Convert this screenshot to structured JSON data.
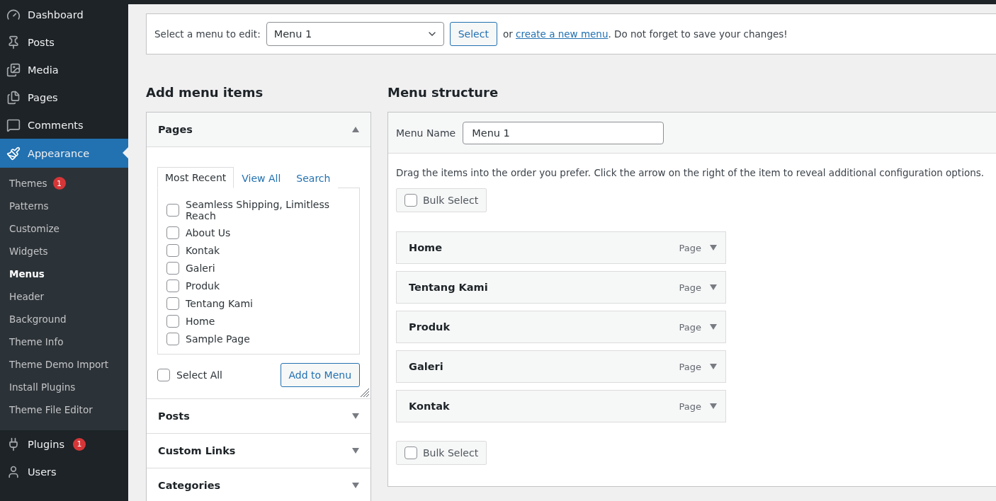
{
  "sidebar": {
    "items": [
      {
        "label": "Dashboard",
        "selected": false
      },
      {
        "label": "Posts",
        "selected": false
      },
      {
        "label": "Media",
        "selected": false
      },
      {
        "label": "Pages",
        "selected": false
      },
      {
        "label": "Comments",
        "selected": false
      },
      {
        "label": "Appearance",
        "selected": true,
        "children": [
          {
            "label": "Themes",
            "selected": false,
            "badge": "1"
          },
          {
            "label": "Patterns",
            "selected": false
          },
          {
            "label": "Customize",
            "selected": false
          },
          {
            "label": "Widgets",
            "selected": false
          },
          {
            "label": "Menus",
            "selected": true
          },
          {
            "label": "Header",
            "selected": false
          },
          {
            "label": "Background",
            "selected": false
          },
          {
            "label": "Theme Info",
            "selected": false
          },
          {
            "label": "Theme Demo Import",
            "selected": false
          },
          {
            "label": "Install Plugins",
            "selected": false
          },
          {
            "label": "Theme File Editor",
            "selected": false
          }
        ]
      },
      {
        "label": "Plugins",
        "selected": false,
        "badge": "1"
      },
      {
        "label": "Users",
        "selected": false
      }
    ]
  },
  "menu_select": {
    "label": "Select a menu to edit:",
    "value": "Menu 1",
    "button": "Select",
    "prefix": "or",
    "link": "create a new menu",
    "suffix": ". Do not forget to save your changes!"
  },
  "add_menu_items": {
    "heading": "Add menu items",
    "sections": [
      {
        "title": "Pages",
        "expanded": true,
        "tabs": [
          {
            "label": "Most Recent",
            "selected": true
          },
          {
            "label": "View All",
            "selected": false
          },
          {
            "label": "Search",
            "selected": false
          }
        ],
        "items": [
          {
            "label": "Seamless Shipping, Limitless Reach",
            "checked": false
          },
          {
            "label": "About Us",
            "checked": false
          },
          {
            "label": "Kontak",
            "checked": false
          },
          {
            "label": "Galeri",
            "checked": false
          },
          {
            "label": "Produk",
            "checked": false
          },
          {
            "label": "Tentang Kami",
            "checked": false
          },
          {
            "label": "Home",
            "checked": false
          },
          {
            "label": "Sample Page",
            "checked": false
          }
        ],
        "select_all": {
          "label": "Select All",
          "checked": false
        },
        "button": "Add to Menu"
      },
      {
        "title": "Posts",
        "expanded": false
      },
      {
        "title": "Custom Links",
        "expanded": false
      },
      {
        "title": "Categories",
        "expanded": false
      }
    ]
  },
  "menu_structure": {
    "heading": "Menu structure",
    "name_label": "Menu Name",
    "name_value": "Menu 1",
    "instructions": "Drag the items into the order you prefer. Click the arrow on the right of the item to reveal additional configuration options.",
    "bulk_select_top": {
      "label": "Bulk Select",
      "checked": false
    },
    "items": [
      {
        "title": "Home",
        "type": "Page"
      },
      {
        "title": "Tentang Kami",
        "type": "Page"
      },
      {
        "title": "Produk",
        "type": "Page"
      },
      {
        "title": "Galeri",
        "type": "Page"
      },
      {
        "title": "Kontak",
        "type": "Page"
      }
    ],
    "bulk_select_bottom": {
      "label": "Bulk Select",
      "checked": false
    }
  }
}
